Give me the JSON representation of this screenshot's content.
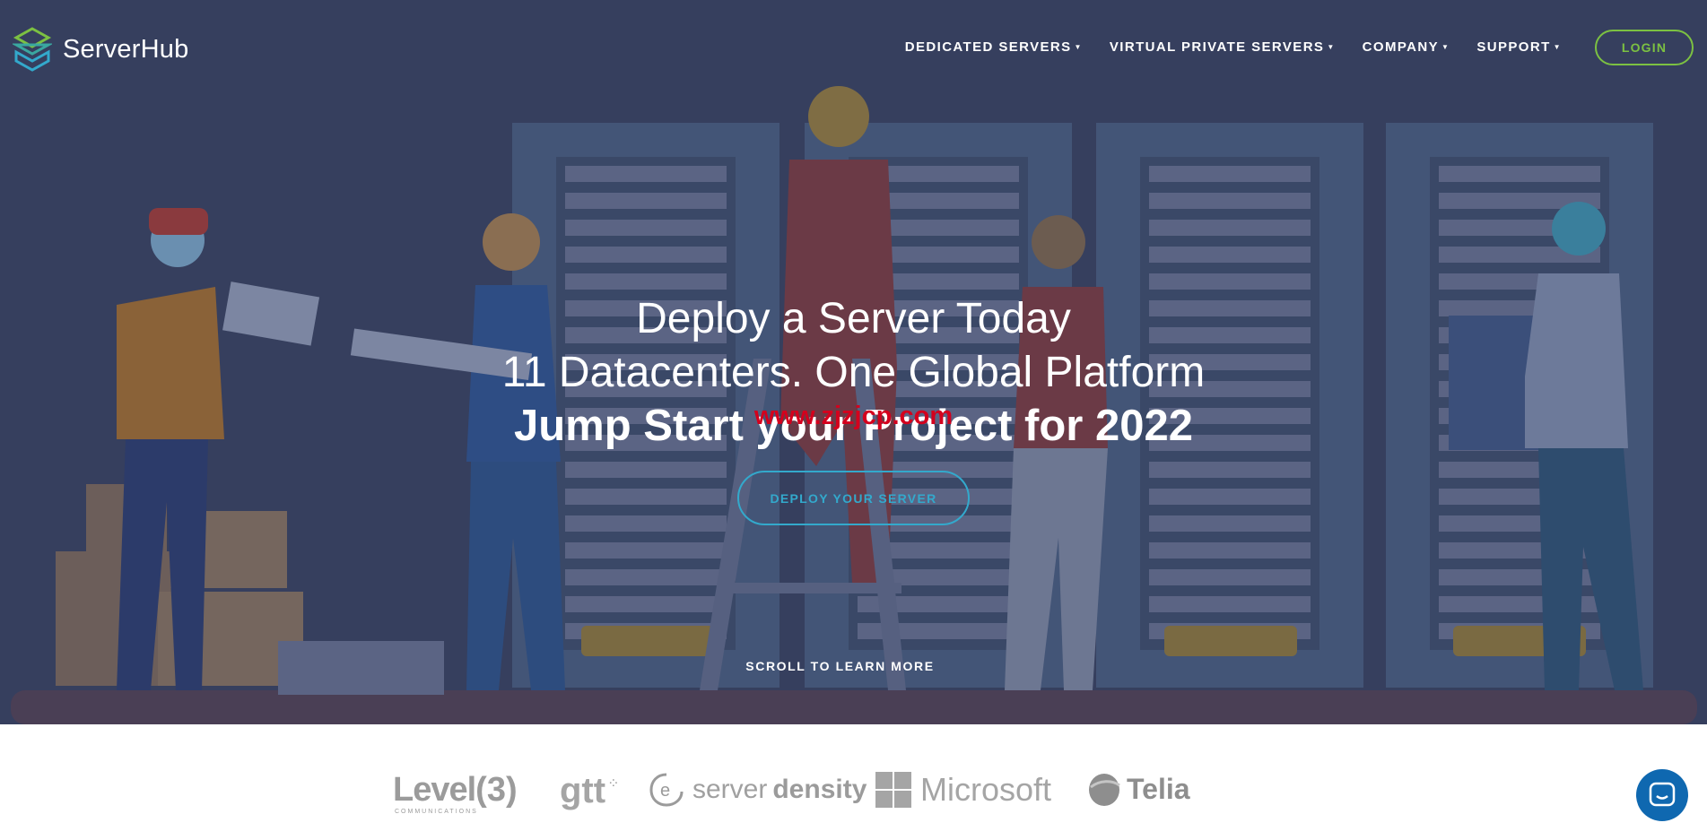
{
  "brand": {
    "name": "ServerHub"
  },
  "nav": {
    "items": [
      {
        "label": "DEDICATED SERVERS"
      },
      {
        "label": "VIRTUAL PRIVATE SERVERS"
      },
      {
        "label": "COMPANY"
      },
      {
        "label": "SUPPORT"
      }
    ],
    "login_label": "LOGIN"
  },
  "hero": {
    "line1": "Deploy a Server Today",
    "line2": "11 Datacenters. One Global Platform",
    "line3": "Jump Start your Project for 2022",
    "watermark": "www.zjzjcp.com",
    "cta_label": "DEPLOY YOUR SERVER",
    "scroll_label": "SCROLL TO LEARN MORE"
  },
  "partners": {
    "level3": {
      "name": "Level",
      "mark": "(3)",
      "sub": "COMMUNICATIONS"
    },
    "gtt": {
      "name": "gtt"
    },
    "serverdensity": {
      "light": "server",
      "bold": "density"
    },
    "microsoft": {
      "name": "Microsoft"
    },
    "telia": {
      "name": "Telia"
    }
  },
  "colors": {
    "hero_bg": "#363f5e",
    "accent_green": "#7cc142",
    "accent_blue": "#33a9cc",
    "chat_blue": "#0f68b0",
    "partner_gray": "#9b9b9b"
  },
  "icons": {
    "logo": "serverhub-cube-logo-icon",
    "caret": "caret-down-icon",
    "chat": "chat-bubble-icon"
  }
}
